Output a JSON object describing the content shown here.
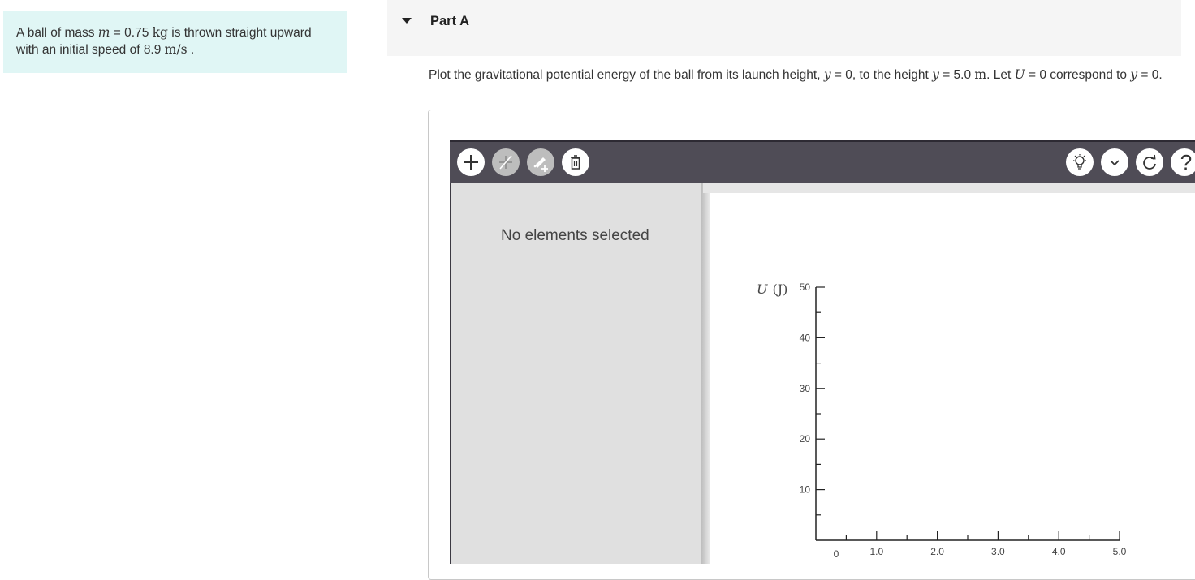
{
  "problem": {
    "text_1": "A ball of mass ",
    "m_symbol": "m",
    "text_2": " = 0.75 ",
    "mass_unit": "kg",
    "text_3": " is thrown straight upward with an initial speed of 8.9 ",
    "speed_unit": "m/s",
    "text_4": " ."
  },
  "part": {
    "title": "Part A"
  },
  "question": {
    "t1": "Plot the gravitational potential energy of the ball from its launch height, ",
    "y1": "y",
    "t2": " = 0, to the height ",
    "y2": "y",
    "t3": " = 5.0 ",
    "unit": "m",
    "t4": ". Let ",
    "U": "U",
    "t5": " = 0 correspond to ",
    "y3": "y",
    "t6": " = 0."
  },
  "toolbar": {
    "left_icons": [
      "plus-icon",
      "line-icon",
      "edit-add-icon",
      "trash-icon"
    ],
    "right_icons": [
      "lightbulb-icon",
      "chevron-down-icon",
      "redo-icon",
      "help-icon"
    ],
    "help_glyph": "?"
  },
  "side_panel": {
    "status": "No elements selected"
  },
  "chart_data": {
    "type": "line",
    "ylabel_symbol": "U",
    "ylabel_unit": "(J)",
    "xlim": [
      0,
      5.0
    ],
    "ylim": [
      0,
      50
    ],
    "x_ticks": [
      "0",
      "1.0",
      "2.0",
      "3.0",
      "4.0",
      "5.0"
    ],
    "y_ticks": [
      "10",
      "20",
      "30",
      "40",
      "50"
    ],
    "series": []
  },
  "colors": {
    "problem_bg": "#e0f6f5",
    "toolbar_bg": "#4f4c56",
    "panel_bg": "#e0e0e0"
  }
}
